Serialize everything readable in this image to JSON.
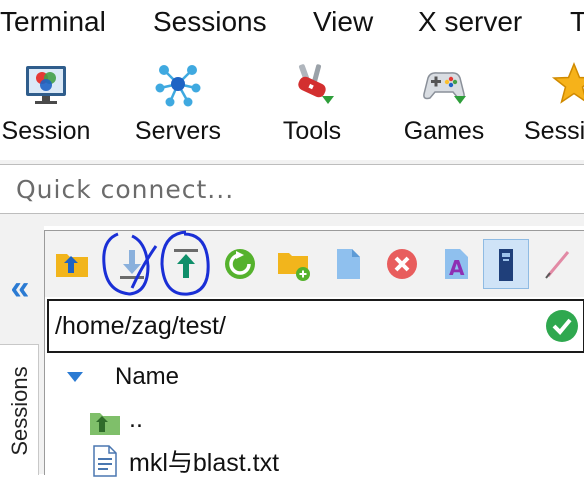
{
  "menubar": {
    "items": [
      "Terminal",
      "Sessions",
      "View",
      "X server",
      "T"
    ]
  },
  "toolbar": {
    "buttons": [
      {
        "label": "Session",
        "icon": "session-monitor-icon"
      },
      {
        "label": "Servers",
        "icon": "servers-network-icon"
      },
      {
        "label": "Tools",
        "icon": "tools-knife-icon"
      },
      {
        "label": "Games",
        "icon": "gamepad-icon"
      },
      {
        "label": "Sessi",
        "icon": "star-icon"
      }
    ]
  },
  "quick_connect": {
    "placeholder": "Quick connect..."
  },
  "sidebar": {
    "collapse_glyph": "«",
    "sessions_tab_label": "Sessions"
  },
  "file_browser": {
    "toolbar_icons": [
      "parent-directory-icon",
      "download-icon",
      "upload-icon",
      "refresh-icon",
      "new-folder-icon",
      "new-file-icon",
      "delete-icon",
      "rename-icon",
      "follow-terminal-icon",
      "edit-icon"
    ],
    "path": "/home/zag/test/",
    "columns": {
      "name": "Name"
    },
    "entries": [
      {
        "name": "..",
        "type": "parent-folder"
      },
      {
        "name": "mkl与blast.txt",
        "type": "text-file"
      }
    ]
  },
  "colors": {
    "accent_blue": "#2b7bd3",
    "upload_green": "#0f8f6a",
    "refresh_green": "#55b22d",
    "delete_red": "#e85d5d",
    "annotation_blue": "#1a2fd6",
    "ok_green": "#2fa84f"
  }
}
